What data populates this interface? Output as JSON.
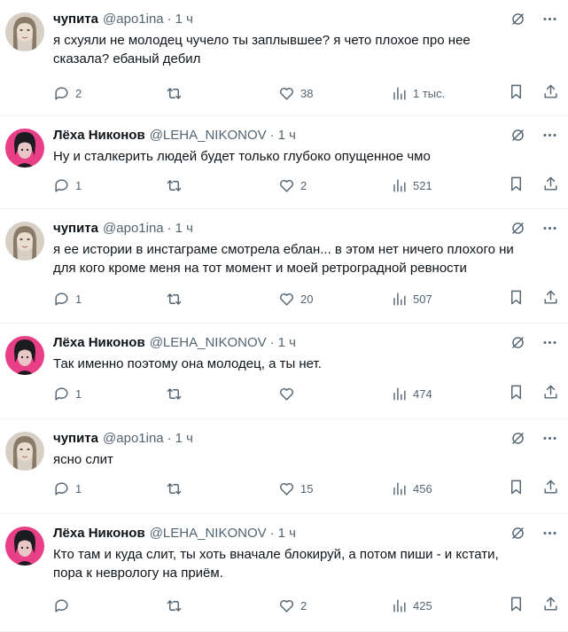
{
  "tweets": [
    {
      "author": "чупита",
      "handle": "@apo1ina",
      "time": "1 ч",
      "avatar": "avatar-chupita",
      "lines": [
        "я схуяли не молодец чучело ты заплывшее? я чето плохое про нее",
        "сказала? ебаный дебил"
      ],
      "replies": "2",
      "retweets": "",
      "likes": "38",
      "views": "1 тыс."
    },
    {
      "author": "Лёха Никонов",
      "handle": "@LEHA_NIKONOV",
      "time": "1 ч",
      "avatar": "avatar-leha",
      "lines": [
        "Ну и сталкерить людей будет только глубоко опущенное чмо"
      ],
      "replies": "1",
      "retweets": "",
      "likes": "2",
      "views": "521"
    },
    {
      "author": "чупита",
      "handle": "@apo1ina",
      "time": "1 ч",
      "avatar": "avatar-chupita",
      "lines": [
        "я ее истории в инстаграме смотрела еблан... в этом нет ничего плохого ни",
        "для кого кроме меня на тот момент и моей ретроградной ревности"
      ],
      "replies": "1",
      "retweets": "",
      "likes": "20",
      "views": "507"
    },
    {
      "author": "Лёха Никонов",
      "handle": "@LEHA_NIKONOV",
      "time": "1 ч",
      "avatar": "avatar-leha",
      "lines": [
        "Так именно поэтому она молодец, а ты нет."
      ],
      "replies": "1",
      "retweets": "",
      "likes": "",
      "views": "474"
    },
    {
      "author": "чупита",
      "handle": "@apo1ina",
      "time": "1 ч",
      "avatar": "avatar-chupita",
      "lines": [
        "ясно слит"
      ],
      "replies": "1",
      "retweets": "",
      "likes": "15",
      "views": "456"
    },
    {
      "author": "Лёха Никонов",
      "handle": "@LEHA_NIKONOV",
      "time": "1 ч",
      "avatar": "avatar-leha",
      "lines": [
        "Кто там и куда слит, ты хоть вначале блокируй, а потом пиши - и кстати,",
        "пора к неврологу на приём."
      ],
      "replies": "",
      "retweets": "",
      "likes": "2",
      "views": "425"
    }
  ],
  "separator": "·"
}
